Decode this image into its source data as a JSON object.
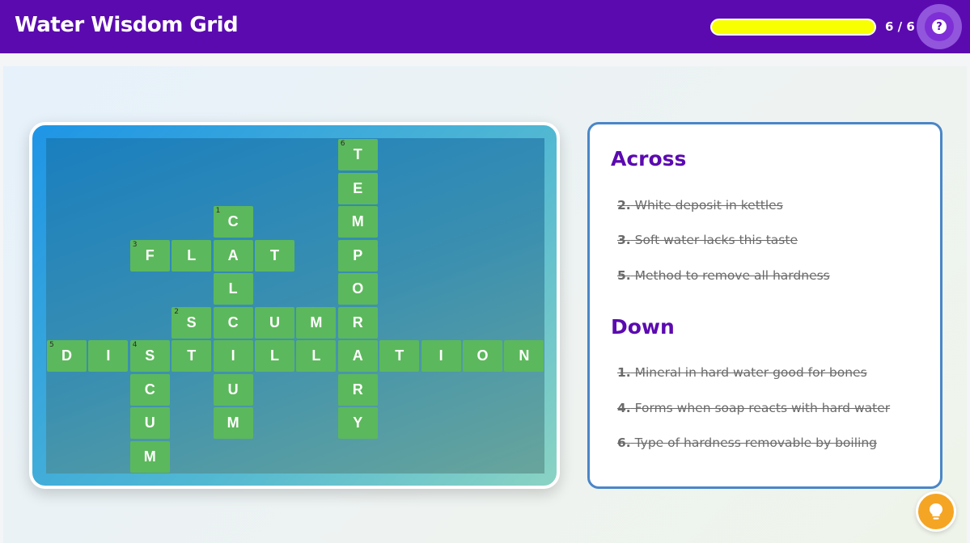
{
  "app": {
    "title": "Water Wisdom Grid"
  },
  "progress": {
    "solved": 6,
    "total": 6,
    "label": "6 / 6",
    "fraction": 1.0
  },
  "help": {
    "icon": "question-icon",
    "glyph": "?"
  },
  "hint": {
    "icon": "lightbulb-icon"
  },
  "grid": {
    "rows": 10,
    "cols": 12,
    "cells": [
      {
        "r": 0,
        "c": 7,
        "l": "T",
        "n": "6"
      },
      {
        "r": 1,
        "c": 7,
        "l": "E"
      },
      {
        "r": 2,
        "c": 4,
        "l": "C",
        "n": "1"
      },
      {
        "r": 2,
        "c": 7,
        "l": "M"
      },
      {
        "r": 3,
        "c": 2,
        "l": "F",
        "n": "3"
      },
      {
        "r": 3,
        "c": 3,
        "l": "L"
      },
      {
        "r": 3,
        "c": 4,
        "l": "A"
      },
      {
        "r": 3,
        "c": 5,
        "l": "T"
      },
      {
        "r": 3,
        "c": 7,
        "l": "P"
      },
      {
        "r": 4,
        "c": 4,
        "l": "L"
      },
      {
        "r": 4,
        "c": 7,
        "l": "O"
      },
      {
        "r": 5,
        "c": 3,
        "l": "S",
        "n": "2"
      },
      {
        "r": 5,
        "c": 4,
        "l": "C"
      },
      {
        "r": 5,
        "c": 5,
        "l": "U"
      },
      {
        "r": 5,
        "c": 6,
        "l": "M"
      },
      {
        "r": 5,
        "c": 7,
        "l": "R"
      },
      {
        "r": 6,
        "c": 0,
        "l": "D",
        "n": "5"
      },
      {
        "r": 6,
        "c": 1,
        "l": "I"
      },
      {
        "r": 6,
        "c": 2,
        "l": "S",
        "n": "4"
      },
      {
        "r": 6,
        "c": 3,
        "l": "T"
      },
      {
        "r": 6,
        "c": 4,
        "l": "I"
      },
      {
        "r": 6,
        "c": 5,
        "l": "L"
      },
      {
        "r": 6,
        "c": 6,
        "l": "L"
      },
      {
        "r": 6,
        "c": 7,
        "l": "A"
      },
      {
        "r": 6,
        "c": 8,
        "l": "T"
      },
      {
        "r": 6,
        "c": 9,
        "l": "I"
      },
      {
        "r": 6,
        "c": 10,
        "l": "O"
      },
      {
        "r": 6,
        "c": 11,
        "l": "N"
      },
      {
        "r": 7,
        "c": 2,
        "l": "C"
      },
      {
        "r": 7,
        "c": 4,
        "l": "U"
      },
      {
        "r": 7,
        "c": 7,
        "l": "R"
      },
      {
        "r": 8,
        "c": 2,
        "l": "U"
      },
      {
        "r": 8,
        "c": 4,
        "l": "M"
      },
      {
        "r": 8,
        "c": 7,
        "l": "Y"
      },
      {
        "r": 9,
        "c": 2,
        "l": "M"
      }
    ]
  },
  "clues": {
    "across_heading": "Across",
    "down_heading": "Down",
    "across": [
      {
        "num": "2.",
        "text": " White deposit in kettles",
        "solved": true
      },
      {
        "num": "3.",
        "text": " Soft water lacks this taste",
        "solved": true
      },
      {
        "num": "5.",
        "text": " Method to remove all hardness",
        "solved": true
      }
    ],
    "down": [
      {
        "num": "1.",
        "text": " Mineral in hard water good for bones",
        "solved": true
      },
      {
        "num": "4.",
        "text": " Forms when soap reacts with hard water",
        "solved": true
      },
      {
        "num": "6.",
        "text": " Type of hardness removable by boiling",
        "solved": true
      }
    ]
  },
  "colors": {
    "header": "#5b0ab0",
    "accent": "#5b0ab0",
    "progress_fill": "#f8ff00",
    "cell_solved": "#5cb85c",
    "hint": "#f5a524",
    "clue_border": "#4a86c8"
  }
}
